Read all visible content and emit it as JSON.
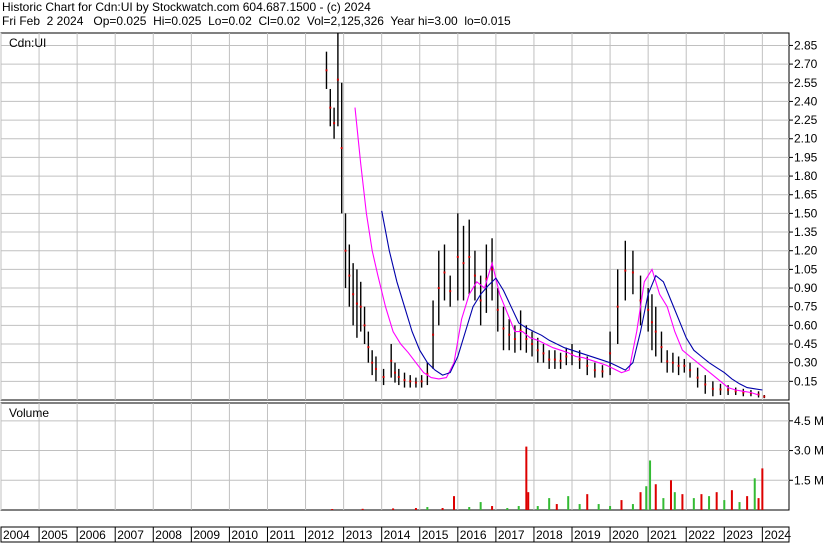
{
  "header": {
    "line1": "Historic Chart for Cdn:UI by Stockwatch.com 604.687.1500 - (c) 2024",
    "line2": "Fri Feb  2 2024   Op=0.025  Hi=0.025  Lo=0.02  Cl=0.02  Vol=2,125,326  Year hi=3.00  lo=0.015"
  },
  "price_panel": {
    "label": "Cdn:UI"
  },
  "volume_panel": {
    "label": "Volume"
  },
  "colors": {
    "price_bars": "#000000",
    "price_points": "#cc0000",
    "ma_short": "#ff00ff",
    "ma_long": "#0000aa",
    "volume_up": "#33bb33",
    "volume_down": "#dd0000",
    "grid": "#c0c0c0"
  },
  "chart_data": [
    {
      "type": "line",
      "title": "Cdn:UI",
      "x_ticks": [
        "2004",
        "2005",
        "2006",
        "2007",
        "2008",
        "2009",
        "2010",
        "2011",
        "2012",
        "2013",
        "2014",
        "2015",
        "2016",
        "2017",
        "2018",
        "2019",
        "2020",
        "2021",
        "2022",
        "2023",
        "2024"
      ],
      "y_ticks": [
        "2.85",
        "2.70",
        "2.55",
        "2.40",
        "2.25",
        "2.10",
        "1.95",
        "1.80",
        "1.65",
        "1.50",
        "1.35",
        "1.20",
        "1.05",
        "0.90",
        "0.75",
        "0.60",
        "0.45",
        "0.30",
        "0.15"
      ],
      "ylim": [
        0,
        2.95
      ],
      "grid": true,
      "series": [
        {
          "style": "price-bars",
          "x": [
            2012.55,
            2012.65,
            2012.75,
            2012.85,
            2012.95,
            2013.05,
            2013.15,
            2013.25,
            2013.35,
            2013.45,
            2013.55,
            2013.65,
            2013.75,
            2013.85,
            2014.05,
            2014.25,
            2014.35,
            2014.45,
            2014.6,
            2014.75,
            2014.9,
            2015.05,
            2015.2,
            2015.35,
            2015.5,
            2015.65,
            2015.8,
            2016.0,
            2016.15,
            2016.3,
            2016.45,
            2016.6,
            2016.75,
            2016.9,
            2017.05,
            2017.2,
            2017.35,
            2017.5,
            2017.65,
            2017.8,
            2017.95,
            2018.1,
            2018.25,
            2018.4,
            2018.55,
            2018.7,
            2018.85,
            2019.0,
            2019.2,
            2019.4,
            2019.6,
            2019.8,
            2020.0,
            2020.2,
            2020.4,
            2020.6,
            2020.8,
            2021.0,
            2021.1,
            2021.2,
            2021.35,
            2021.5,
            2021.65,
            2021.8,
            2021.95,
            2022.1,
            2022.3,
            2022.5,
            2022.7,
            2022.9,
            2023.1,
            2023.3,
            2023.5,
            2023.7,
            2023.9,
            2024.05
          ],
          "high": [
            2.8,
            2.5,
            2.35,
            2.95,
            2.55,
            1.5,
            1.25,
            1.1,
            1.05,
            0.95,
            0.75,
            0.55,
            0.4,
            0.35,
            0.25,
            0.45,
            0.3,
            0.25,
            0.22,
            0.2,
            0.18,
            0.2,
            0.3,
            0.8,
            1.2,
            1.25,
            1.0,
            1.5,
            1.4,
            1.45,
            1.2,
            1.0,
            1.25,
            1.3,
            0.9,
            0.75,
            0.65,
            0.6,
            0.72,
            0.6,
            0.55,
            0.5,
            0.45,
            0.4,
            0.4,
            0.38,
            0.42,
            0.45,
            0.4,
            0.35,
            0.3,
            0.28,
            0.55,
            1.05,
            1.28,
            1.2,
            1.0,
            0.9,
            0.85,
            0.75,
            0.55,
            0.4,
            0.38,
            0.35,
            0.33,
            0.3,
            0.26,
            0.2,
            0.15,
            0.13,
            0.12,
            0.1,
            0.09,
            0.08,
            0.07,
            0.04
          ],
          "low": [
            2.5,
            2.2,
            2.1,
            2.2,
            1.5,
            0.9,
            0.75,
            0.6,
            0.5,
            0.55,
            0.45,
            0.3,
            0.2,
            0.15,
            0.12,
            0.18,
            0.14,
            0.12,
            0.1,
            0.1,
            0.1,
            0.1,
            0.12,
            0.25,
            0.6,
            0.8,
            0.75,
            0.8,
            0.8,
            0.85,
            0.8,
            0.6,
            0.7,
            0.8,
            0.55,
            0.4,
            0.4,
            0.38,
            0.4,
            0.38,
            0.35,
            0.3,
            0.3,
            0.25,
            0.25,
            0.25,
            0.28,
            0.28,
            0.25,
            0.2,
            0.18,
            0.18,
            0.2,
            0.45,
            0.8,
            0.85,
            0.6,
            0.55,
            0.4,
            0.35,
            0.3,
            0.22,
            0.22,
            0.2,
            0.22,
            0.18,
            0.1,
            0.05,
            0.03,
            0.04,
            0.04,
            0.04,
            0.03,
            0.03,
            0.02,
            0.015
          ]
        },
        {
          "name": "",
          "style": "ma-short",
          "x": [
            2013.3,
            2013.45,
            2013.6,
            2013.75,
            2013.9,
            2014.1,
            2014.3,
            2014.5,
            2014.7,
            2014.9,
            2015.1,
            2015.3,
            2015.5,
            2015.7,
            2015.9,
            2016.1,
            2016.3,
            2016.5,
            2016.7,
            2016.9,
            2017.1,
            2017.3,
            2017.5,
            2017.7,
            2017.9,
            2018.1,
            2018.3,
            2018.5,
            2018.7,
            2018.9,
            2019.1,
            2019.3,
            2019.5,
            2019.7,
            2019.9,
            2020.1,
            2020.3,
            2020.5,
            2020.7,
            2020.9,
            2021.1,
            2021.3,
            2021.5,
            2021.7,
            2021.9,
            2022.1,
            2022.3,
            2022.5,
            2022.7,
            2022.9,
            2023.1,
            2023.3,
            2023.5,
            2023.7,
            2023.9
          ],
          "values": [
            2.35,
            1.9,
            1.5,
            1.2,
            1.0,
            0.75,
            0.55,
            0.45,
            0.38,
            0.3,
            0.22,
            0.18,
            0.17,
            0.18,
            0.3,
            0.65,
            0.85,
            0.95,
            0.9,
            1.1,
            0.85,
            0.7,
            0.55,
            0.55,
            0.5,
            0.48,
            0.45,
            0.42,
            0.4,
            0.38,
            0.35,
            0.34,
            0.32,
            0.3,
            0.28,
            0.25,
            0.22,
            0.24,
            0.55,
            0.95,
            1.05,
            0.85,
            0.75,
            0.55,
            0.4,
            0.35,
            0.3,
            0.25,
            0.2,
            0.15,
            0.1,
            0.08,
            0.07,
            0.06,
            0.04
          ]
        },
        {
          "name": "",
          "style": "ma-long",
          "x": [
            2014.0,
            2014.2,
            2014.4,
            2014.6,
            2014.8,
            2015.0,
            2015.2,
            2015.4,
            2015.6,
            2015.8,
            2016.0,
            2016.2,
            2016.4,
            2016.6,
            2016.8,
            2017.0,
            2017.2,
            2017.4,
            2017.6,
            2017.8,
            2018.0,
            2018.2,
            2018.4,
            2018.6,
            2018.8,
            2019.0,
            2019.2,
            2019.4,
            2019.6,
            2019.8,
            2020.0,
            2020.2,
            2020.4,
            2020.6,
            2020.8,
            2021.0,
            2021.2,
            2021.4,
            2021.6,
            2021.8,
            2022.0,
            2022.2,
            2022.4,
            2022.6,
            2022.8,
            2023.0,
            2023.2,
            2023.4,
            2023.6,
            2023.8,
            2024.0
          ],
          "values": [
            1.52,
            1.2,
            0.95,
            0.75,
            0.55,
            0.4,
            0.3,
            0.24,
            0.2,
            0.22,
            0.35,
            0.55,
            0.75,
            0.85,
            0.92,
            0.98,
            0.88,
            0.75,
            0.62,
            0.58,
            0.55,
            0.52,
            0.48,
            0.45,
            0.42,
            0.4,
            0.38,
            0.36,
            0.34,
            0.32,
            0.3,
            0.27,
            0.24,
            0.3,
            0.55,
            0.85,
            1.0,
            0.95,
            0.8,
            0.65,
            0.5,
            0.4,
            0.35,
            0.3,
            0.26,
            0.22,
            0.17,
            0.13,
            0.1,
            0.09,
            0.08
          ]
        }
      ]
    },
    {
      "type": "bar",
      "title": "Volume",
      "y_ticks": [
        "4.5 M",
        "3.0 M",
        "1.5 M"
      ],
      "ylim": [
        0,
        5.4
      ],
      "grid": true,
      "series": [
        {
          "x": [
            2012.7,
            2013.5,
            2014.3,
            2014.9,
            2015.2,
            2015.6,
            2015.9,
            2016.3,
            2016.6,
            2016.9,
            2017.3,
            2017.6,
            2017.8,
            2017.85,
            2018.1,
            2018.4,
            2018.6,
            2018.9,
            2019.2,
            2019.4,
            2019.7,
            2020.0,
            2020.3,
            2020.6,
            2020.8,
            2020.95,
            2021.05,
            2021.2,
            2021.4,
            2021.6,
            2021.7,
            2021.9,
            2022.2,
            2022.4,
            2022.6,
            2022.8,
            2023.0,
            2023.2,
            2023.4,
            2023.6,
            2023.8,
            2023.9,
            2024.0
          ],
          "values": [
            0.05,
            0.06,
            0.08,
            0.1,
            0.15,
            0.1,
            0.7,
            0.15,
            0.4,
            0.2,
            0.1,
            0.2,
            3.2,
            0.9,
            0.2,
            0.6,
            0.3,
            0.7,
            0.3,
            0.8,
            0.3,
            0.2,
            0.5,
            0.3,
            0.9,
            1.2,
            2.5,
            1.3,
            0.6,
            1.5,
            0.9,
            0.8,
            0.6,
            0.8,
            0.7,
            0.9,
            0.5,
            1.0,
            0.4,
            0.7,
            1.6,
            0.6,
            2.1
          ],
          "colors": [
            "down",
            "down",
            "down",
            "down",
            "up",
            "down",
            "down",
            "up",
            "up",
            "down",
            "up",
            "up",
            "down",
            "down",
            "up",
            "up",
            "down",
            "up",
            "up",
            "down",
            "up",
            "up",
            "down",
            "up",
            "down",
            "up",
            "up",
            "down",
            "up",
            "down",
            "up",
            "down",
            "up",
            "down",
            "up",
            "down",
            "up",
            "down",
            "up",
            "down",
            "up",
            "down",
            "down"
          ]
        }
      ]
    }
  ]
}
